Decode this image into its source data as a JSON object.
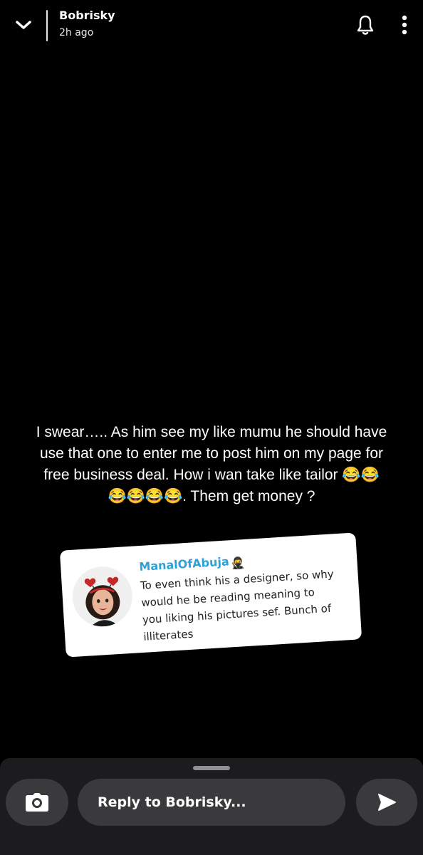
{
  "header": {
    "title": "Bobrisky",
    "time": "2h ago",
    "icons": [
      "chevron-down-icon",
      "bell-icon",
      "more-vertical-icon"
    ]
  },
  "story": {
    "caption_line1": "I swear….. As him see my like mumu he should have",
    "caption_line2": "use that one to enter me to post him on my page for",
    "caption_line3a": "free business deal. How i wan take like tailor",
    "caption_line3_emoji": "😂😂",
    "caption_line4_emoji": "😂😂😂😂",
    "caption_line4b": ". Them get money ?"
  },
  "comment_card": {
    "username": "ManalOfAbuja",
    "username_emoji": "🥷",
    "text_line1": "To even think his a designer, so why",
    "text_line2": "would he be reading meaning to",
    "text_line3": "you liking his pictures sef. Bunch of",
    "text_line4": "illiterates",
    "avatar_icon": "bitmoji-avatar-icon"
  },
  "bottom_bar": {
    "reply_placeholder": "Reply to Bobrisky...",
    "icons": [
      "camera-icon",
      "send-icon"
    ]
  },
  "colors": {
    "background": "#000000",
    "bar_background": "#1c1c1e",
    "pill_background": "#3a3a3c",
    "username_accent": "#2aa3d8",
    "card_background": "#ffffff"
  }
}
